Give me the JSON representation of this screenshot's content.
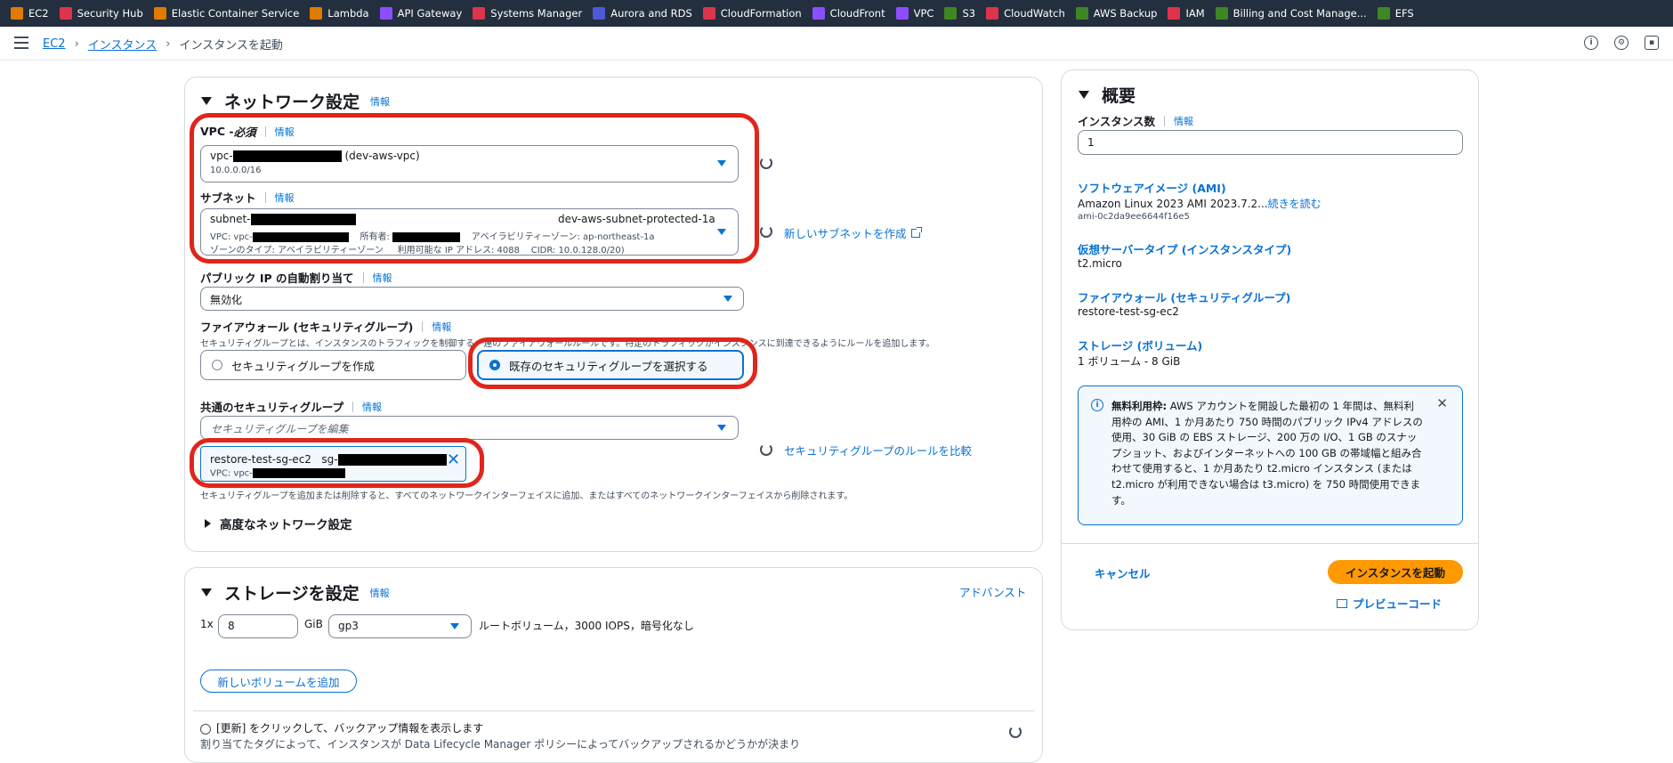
{
  "services": [
    {
      "label": "EC2",
      "color": "#e07b00",
      "icon": "ec2-icon"
    },
    {
      "label": "Security Hub",
      "color": "#dd344c",
      "icon": "security-hub-icon"
    },
    {
      "label": "Elastic Container Service",
      "color": "#e07b00",
      "icon": "ecs-icon"
    },
    {
      "label": "Lambda",
      "color": "#e07b00",
      "icon": "lambda-icon"
    },
    {
      "label": "API Gateway",
      "color": "#8c4fff",
      "icon": "api-gateway-icon"
    },
    {
      "label": "Systems Manager",
      "color": "#dd344c",
      "icon": "systems-manager-icon"
    },
    {
      "label": "Aurora and RDS",
      "color": "#4d5ad6",
      "icon": "rds-icon"
    },
    {
      "label": "CloudFormation",
      "color": "#dd344c",
      "icon": "cloudformation-icon"
    },
    {
      "label": "CloudFront",
      "color": "#8c4fff",
      "icon": "cloudfront-icon"
    },
    {
      "label": "VPC",
      "color": "#8c4fff",
      "icon": "vpc-icon"
    },
    {
      "label": "S3",
      "color": "#3f8624",
      "icon": "s3-icon"
    },
    {
      "label": "CloudWatch",
      "color": "#dd344c",
      "icon": "cloudwatch-icon"
    },
    {
      "label": "AWS Backup",
      "color": "#3f8624",
      "icon": "backup-icon"
    },
    {
      "label": "IAM",
      "color": "#dd344c",
      "icon": "iam-icon"
    },
    {
      "label": "Billing and Cost Manage...",
      "color": "#3f8624",
      "icon": "billing-icon"
    },
    {
      "label": "EFS",
      "color": "#3f8624",
      "icon": "efs-icon"
    }
  ],
  "breadcrumb": {
    "ec2": "EC2",
    "instances": "インスタンス",
    "current": "インスタンスを起動"
  },
  "network": {
    "title": "ネットワーク設定",
    "info": "情報",
    "vpc_label": "VPC - ",
    "vpc_required": "必須",
    "vpc_prefix": "vpc-",
    "vpc_name": "(dev-aws-vpc)",
    "vpc_cidr": "10.0.0.0/16",
    "subnet_label": "サブネット",
    "subnet_prefix": "subnet-",
    "subnet_name": "dev-aws-subnet-protected-1a",
    "subnet_vpc": "VPC: vpc-",
    "subnet_owner": "所有者:",
    "subnet_az": "アベイラビリティーゾーン: ap-northeast-1a",
    "subnet_zone_type": "ゾーンのタイプ: アベイラビリティーゾーン",
    "subnet_ips": "利用可能な IP アドレス: 4088",
    "subnet_cidr": "CIDR: 10.0.128.0/20)",
    "new_subnet": "新しいサブネットを作成",
    "public_ip_label": "パブリック IP の自動割り当て",
    "public_ip_value": "無効化",
    "firewall_label": "ファイアウォール (セキュリティグループ)",
    "firewall_help": "セキュリティグループとは、インスタンスのトラフィックを制御する一連のファイアウォールルールです。特定のトラフィックがインスタンスに到達できるようにルールを追加します。",
    "create_sg": "セキュリティグループを作成",
    "select_sg": "既存のセキュリティグループを選択する",
    "common_sg_label": "共通のセキュリティグループ",
    "sg_placeholder": "セキュリティグループを編集",
    "compare_rules": "セキュリティグループのルールを比較",
    "sg_tag_name": "restore-test-sg-ec2",
    "sg_tag_id_prefix": "sg-",
    "sg_tag_vpc": "VPC: vpc-",
    "sg_help": "セキュリティグループを追加または削除すると、すべてのネットワークインターフェイスに追加、またはすべてのネットワークインターフェイスから削除されます。",
    "advanced": "高度なネットワーク設定"
  },
  "storage": {
    "title": "ストレージを設定",
    "info": "情報",
    "advanced": "アドバンスト",
    "multiplier": "1x",
    "size": "8",
    "unit": "GiB",
    "type": "gp3",
    "desc": "ルートボリューム，3000 IOPS，暗号化なし",
    "add_volume": "新しいボリュームを追加",
    "backup_title": "[更新] をクリックして、バックアップ情報を表示します",
    "backup_desc": "割り当てたタグによって、インスタンスが Data Lifecycle Manager ポリシーによってバックアップされるかどうかが決まり"
  },
  "summary": {
    "title": "概要",
    "count_label": "インスタンス数",
    "info": "情報",
    "count": "1",
    "ami_label": "ソフトウェアイメージ (AMI)",
    "ami_value": "Amazon Linux 2023 AMI 2023.7.2...",
    "ami_more": "続きを読む",
    "ami_id": "ami-0c2da9ee6644f16e5",
    "type_label": "仮想サーバータイプ (インスタンスタイプ)",
    "type_value": "t2.micro",
    "fw_label": "ファイアウォール (セキュリティグループ)",
    "fw_value": "restore-test-sg-ec2",
    "storage_label": "ストレージ (ボリューム)",
    "storage_value": "1 ボリューム - 8 GiB",
    "notice_bold": "無料利用枠:",
    "notice_text": " AWS アカウントを開設した最初の 1 年間は、無料利用枠の AMI、1 か月あたり 750 時間のパブリック IPv4 アドレスの使用、30 GiB の EBS ストレージ、200 万の I/O、1 GB のスナップショット、およびインターネットへの 100 GB の帯域幅と組み合わせて使用すると、1 か月あたり t2.micro インスタンス (または t2.micro が利用できない場合は t3.micro) を 750 時間使用できます。",
    "cancel": "キャンセル",
    "launch": "インスタンスを起動",
    "preview": "プレビューコード"
  }
}
